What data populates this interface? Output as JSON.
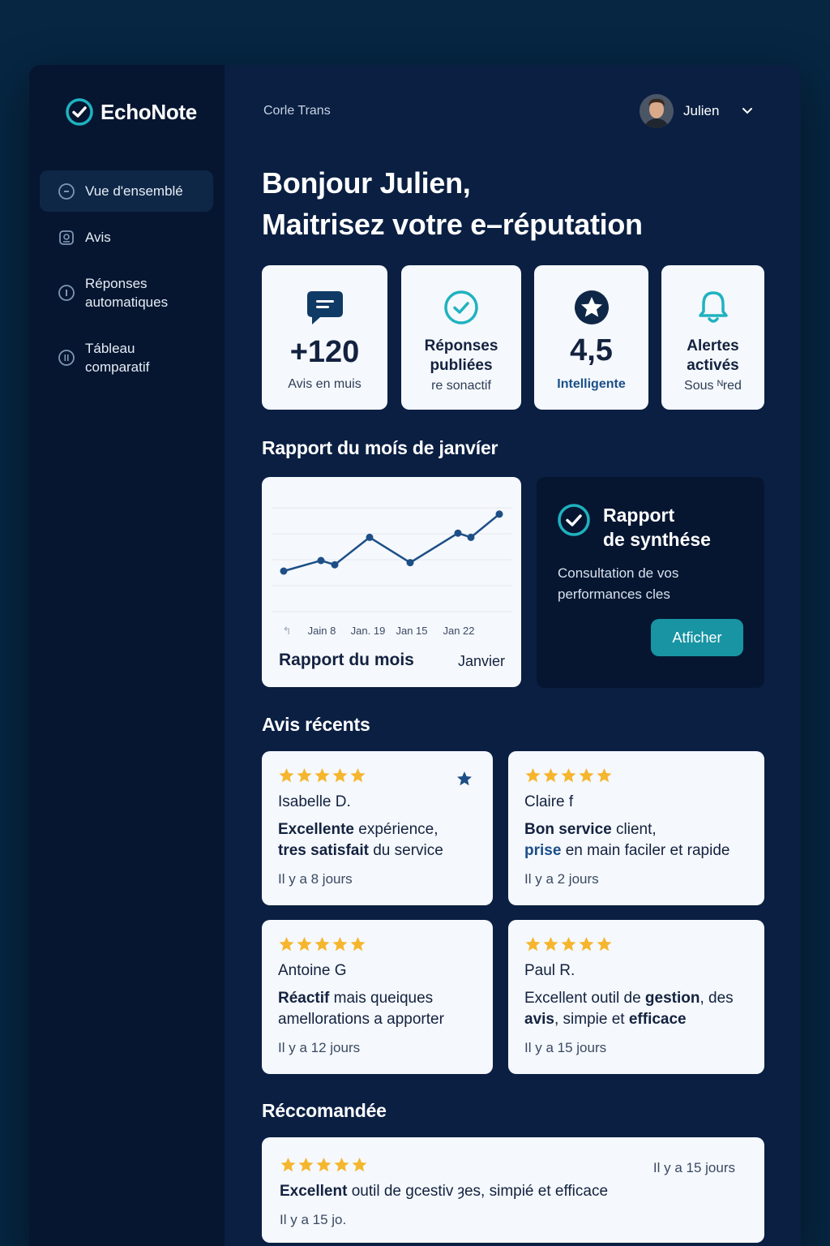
{
  "brand": {
    "name": "EchoNote",
    "accent": "#1fb2c0"
  },
  "sidebar": {
    "items": [
      {
        "label": "Vue d'ensemblé",
        "icon": "overview-icon",
        "active": true
      },
      {
        "label": "Avis",
        "icon": "reviews-icon",
        "active": false
      },
      {
        "label": "Réponses\nautomatiques",
        "icon": "auto-reply-icon",
        "active": false
      },
      {
        "label": "Tábleau\ncomparatif",
        "icon": "compare-icon",
        "active": false
      }
    ]
  },
  "header": {
    "title": "Corle Trans",
    "user_name": "Julien"
  },
  "greeting": {
    "line1": "Bonjour Julien,",
    "line2": "Maitrisez votre e–réputation"
  },
  "stats": [
    {
      "icon": "chat-icon",
      "value": "+120",
      "label": "Avis en muis"
    },
    {
      "icon": "check-circle-icon",
      "title": "Réponses\npubliées",
      "label": "re sonactif"
    },
    {
      "icon": "star-circle-icon",
      "value": "4,5",
      "label": "Intelligente"
    },
    {
      "icon": "bell-icon",
      "title": "Alertes\nactivés",
      "label": "Sous ᴺred"
    }
  ],
  "report": {
    "section_title": "Rapport du moís de janvíer",
    "chart_footer_left": "Rapport du mois",
    "chart_footer_right": "Janvier",
    "synthesis_title": "Rapport\nde synthése",
    "synthesis_desc": "Consultation de vos\nperformances cles",
    "synthesis_button": "Atficher"
  },
  "chart_data": {
    "type": "line",
    "x": [
      "",
      "Jain 8",
      "",
      "Jan. 19",
      "",
      "Jan 15",
      "",
      "",
      "Jan 22"
    ],
    "tick_labels": [
      "↰",
      "Jain 8",
      "Jan. 19",
      "Jan 15",
      "Jan 22"
    ],
    "series": [
      {
        "values": [
          2.0,
          2.5,
          2.3,
          3.6,
          2.4,
          3.8,
          3.6,
          4.7
        ]
      }
    ],
    "ylim": [
      0,
      5
    ],
    "grid": true,
    "color": "#1d4f86"
  },
  "recent": {
    "section_title": "Avis récents",
    "reviews": [
      {
        "name": "Isabelle D.",
        "text_bold": "Excellente",
        "text_rest": " expérience,",
        "text_bold2": "tres satisfait",
        "text_rest2": " du service",
        "date": "Il y a 8 jours",
        "stars": 5,
        "bookmarked": true
      },
      {
        "name": "Claire f",
        "text_bold": "Bon service",
        "text_rest": " client,",
        "text_bold2": "prise",
        "text_rest2": " en main faciler et rapide",
        "date": "Il y a 2 jours",
        "stars": 5
      },
      {
        "name": "Antoine G",
        "text_bold": "Réactif",
        "text_rest": " mais queiques",
        "text_bold2": "",
        "text_rest2": "amellorations a apporter",
        "date": "Il y a 12 jours",
        "stars": 5
      },
      {
        "name": "Paul R.",
        "text_rest": "Excellent outil de ",
        "text_bold": "gestion",
        "text_rest_b": ", des",
        "text_bold2": "avis",
        "text_rest2": ", simpie et ",
        "text_bold3": "efficace",
        "date": "Il y a 15 jours",
        "stars": 5
      }
    ]
  },
  "recommended": {
    "section_title": "Réccomandée",
    "date_right": "Il y a 15 jours",
    "text_bold": "Excellent",
    "text_rest": " outil de gcestiv ȝes, simpié et efficace",
    "date": "Il y a 15 jo.",
    "stars": 5
  },
  "colors": {
    "star": "#f5b62e",
    "card": "#f5f8fc",
    "bg": "#0a1f42",
    "sidebar": "#061631"
  }
}
